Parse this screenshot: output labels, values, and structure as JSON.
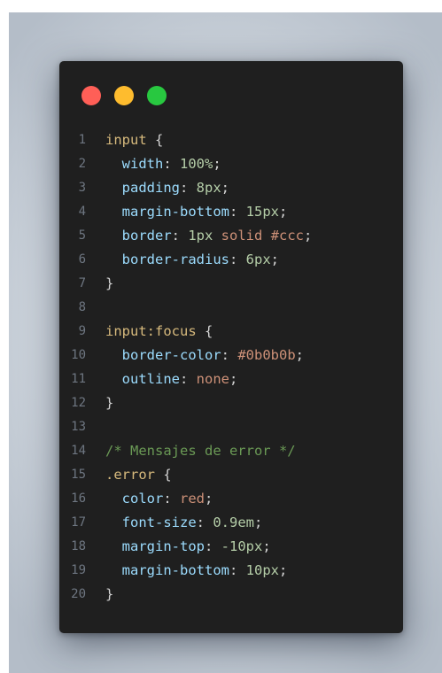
{
  "window": {
    "controls": [
      {
        "name": "close",
        "color": "#ff5f57"
      },
      {
        "name": "minimize",
        "color": "#febc2e"
      },
      {
        "name": "maximize",
        "color": "#28c840"
      }
    ]
  },
  "code": {
    "language": "css",
    "lines": [
      {
        "n": "1",
        "tokens": [
          {
            "t": "input",
            "c": "sel"
          },
          {
            "t": " {",
            "c": "punc"
          }
        ]
      },
      {
        "n": "2",
        "tokens": [
          {
            "t": "  width",
            "c": "prop"
          },
          {
            "t": ": ",
            "c": "punc"
          },
          {
            "t": "100%",
            "c": "num"
          },
          {
            "t": ";",
            "c": "punc"
          }
        ]
      },
      {
        "n": "3",
        "tokens": [
          {
            "t": "  padding",
            "c": "prop"
          },
          {
            "t": ": ",
            "c": "punc"
          },
          {
            "t": "8px",
            "c": "num"
          },
          {
            "t": ";",
            "c": "punc"
          }
        ]
      },
      {
        "n": "4",
        "tokens": [
          {
            "t": "  margin-bottom",
            "c": "prop"
          },
          {
            "t": ": ",
            "c": "punc"
          },
          {
            "t": "15px",
            "c": "num"
          },
          {
            "t": ";",
            "c": "punc"
          }
        ]
      },
      {
        "n": "5",
        "tokens": [
          {
            "t": "  border",
            "c": "prop"
          },
          {
            "t": ": ",
            "c": "punc"
          },
          {
            "t": "1px",
            "c": "num"
          },
          {
            "t": " ",
            "c": "punc"
          },
          {
            "t": "solid",
            "c": "str"
          },
          {
            "t": " ",
            "c": "punc"
          },
          {
            "t": "#ccc",
            "c": "str"
          },
          {
            "t": ";",
            "c": "punc"
          }
        ]
      },
      {
        "n": "6",
        "tokens": [
          {
            "t": "  border-radius",
            "c": "prop"
          },
          {
            "t": ": ",
            "c": "punc"
          },
          {
            "t": "6px",
            "c": "num"
          },
          {
            "t": ";",
            "c": "punc"
          }
        ]
      },
      {
        "n": "7",
        "tokens": [
          {
            "t": "}",
            "c": "punc"
          }
        ]
      },
      {
        "n": "8",
        "tokens": []
      },
      {
        "n": "9",
        "tokens": [
          {
            "t": "input:focus",
            "c": "sel"
          },
          {
            "t": " {",
            "c": "punc"
          }
        ]
      },
      {
        "n": "10",
        "tokens": [
          {
            "t": "  border-color",
            "c": "prop"
          },
          {
            "t": ": ",
            "c": "punc"
          },
          {
            "t": "#0b0b0b",
            "c": "str"
          },
          {
            "t": ";",
            "c": "punc"
          }
        ]
      },
      {
        "n": "11",
        "tokens": [
          {
            "t": "  outline",
            "c": "prop"
          },
          {
            "t": ": ",
            "c": "punc"
          },
          {
            "t": "none",
            "c": "str"
          },
          {
            "t": ";",
            "c": "punc"
          }
        ]
      },
      {
        "n": "12",
        "tokens": [
          {
            "t": "}",
            "c": "punc"
          }
        ]
      },
      {
        "n": "13",
        "tokens": []
      },
      {
        "n": "14",
        "tokens": [
          {
            "t": "/* Mensajes de error */",
            "c": "comment"
          }
        ]
      },
      {
        "n": "15",
        "tokens": [
          {
            "t": ".error",
            "c": "sel"
          },
          {
            "t": " {",
            "c": "punc"
          }
        ]
      },
      {
        "n": "16",
        "tokens": [
          {
            "t": "  color",
            "c": "prop"
          },
          {
            "t": ": ",
            "c": "punc"
          },
          {
            "t": "red",
            "c": "str"
          },
          {
            "t": ";",
            "c": "punc"
          }
        ]
      },
      {
        "n": "17",
        "tokens": [
          {
            "t": "  font-size",
            "c": "prop"
          },
          {
            "t": ": ",
            "c": "punc"
          },
          {
            "t": "0.9em",
            "c": "num"
          },
          {
            "t": ";",
            "c": "punc"
          }
        ]
      },
      {
        "n": "18",
        "tokens": [
          {
            "t": "  margin-top",
            "c": "prop"
          },
          {
            "t": ": ",
            "c": "punc"
          },
          {
            "t": "-10px",
            "c": "num"
          },
          {
            "t": ";",
            "c": "punc"
          }
        ]
      },
      {
        "n": "19",
        "tokens": [
          {
            "t": "  margin-bottom",
            "c": "prop"
          },
          {
            "t": ": ",
            "c": "punc"
          },
          {
            "t": "10px",
            "c": "num"
          },
          {
            "t": ";",
            "c": "punc"
          }
        ]
      },
      {
        "n": "20",
        "tokens": [
          {
            "t": "}",
            "c": "punc"
          }
        ]
      }
    ]
  }
}
